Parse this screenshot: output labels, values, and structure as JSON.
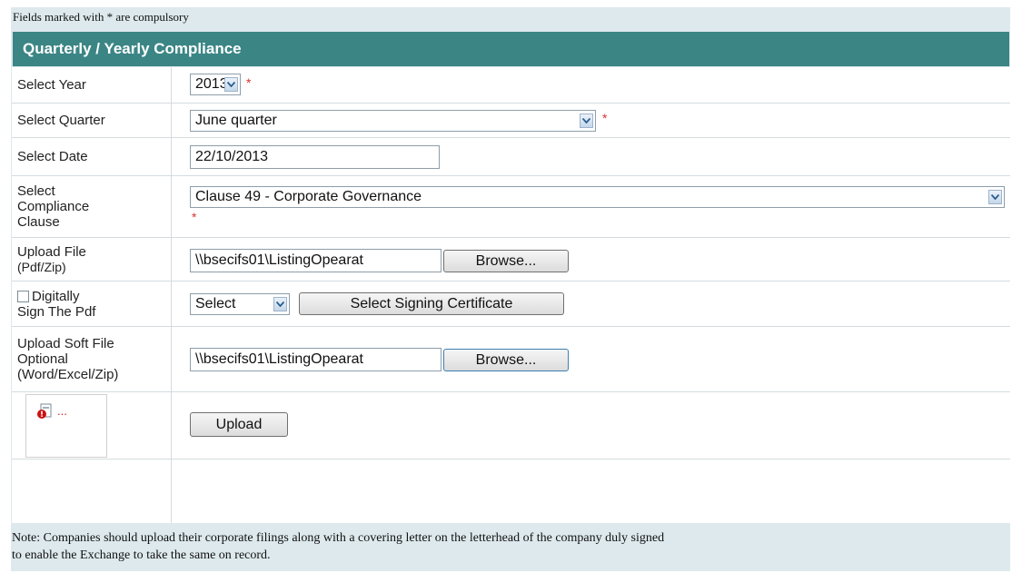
{
  "notice": "Fields marked with * are compulsory",
  "section_title": "Quarterly / Yearly Compliance",
  "required_marker": "*",
  "fields": {
    "year": {
      "label": "Select Year",
      "value": "2013"
    },
    "quarter": {
      "label": "Select Quarter",
      "value": "June quarter"
    },
    "date": {
      "label": "Select Date",
      "value": "22/10/2013"
    },
    "clause": {
      "label_lines": [
        "Select",
        "Compliance",
        "Clause"
      ],
      "value": "Clause 49 - Corporate Governance"
    },
    "upload_file": {
      "label_lines": [
        "Upload File",
        "(Pdf/Zip)"
      ],
      "value": "\\\\bsecifs01\\ListingOpearat",
      "browse_label": "Browse..."
    },
    "digital_sign": {
      "label_lines": [
        "Digitally",
        "Sign The Pdf"
      ],
      "select_value": "Select",
      "button_label": "Select Signing Certificate"
    },
    "upload_soft_file": {
      "label_lines": [
        "Upload Soft File",
        "Optional",
        "(Word/Excel/Zip)"
      ],
      "value": "\\\\bsecifs01\\ListingOpearat",
      "browse_label": "Browse..."
    }
  },
  "upload_button_label": "Upload",
  "broken_image": {
    "icon": "broken-image-icon",
    "text": "..."
  },
  "footer_note_lines": [
    "Note: Companies should upload their corporate filings along with a covering letter on the letterhead of the company duly signed",
    "to enable the Exchange to take the same on record."
  ],
  "colors": {
    "header_bg": "#3b8585",
    "panel_bg": "#dde9ed",
    "required": "#dd3333"
  }
}
